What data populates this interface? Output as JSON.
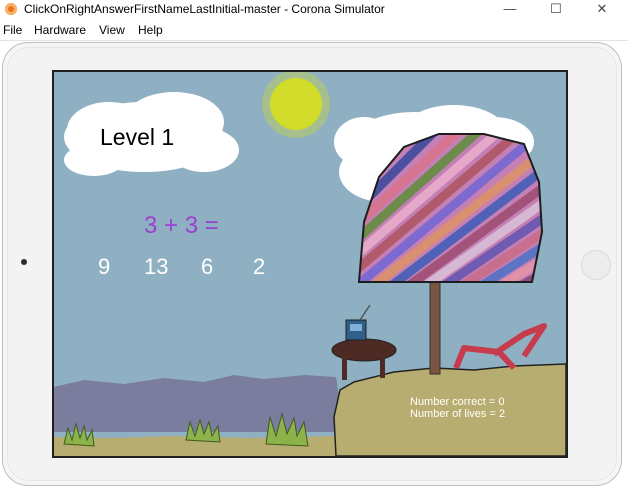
{
  "window": {
    "title": "ClickOnRightAnswerFirstNameLastInitial-master - Corona Simulator",
    "minimize": "—",
    "maximize": "☐",
    "close": "✕"
  },
  "menu": [
    "File",
    "Hardware",
    "View",
    "Help"
  ],
  "game": {
    "level": "Level 1",
    "question": "3 + 3 =",
    "answers": [
      "9",
      "13",
      "6",
      "2"
    ],
    "number_correct": "Number correct = 0",
    "number_of_lives": "Number of lives = 2"
  },
  "colors": {
    "sky": "#8fb0c2",
    "sun": "#d1dc2b",
    "question": "#9a3fd0",
    "sand": "#b8ad70",
    "mountains": "#7a7d9e",
    "grass": "#8cb24a",
    "tree_trunk": "#7a5542",
    "chair": "#c63c4d",
    "table": "#4d2b24",
    "radio": "#2f5f8a"
  }
}
